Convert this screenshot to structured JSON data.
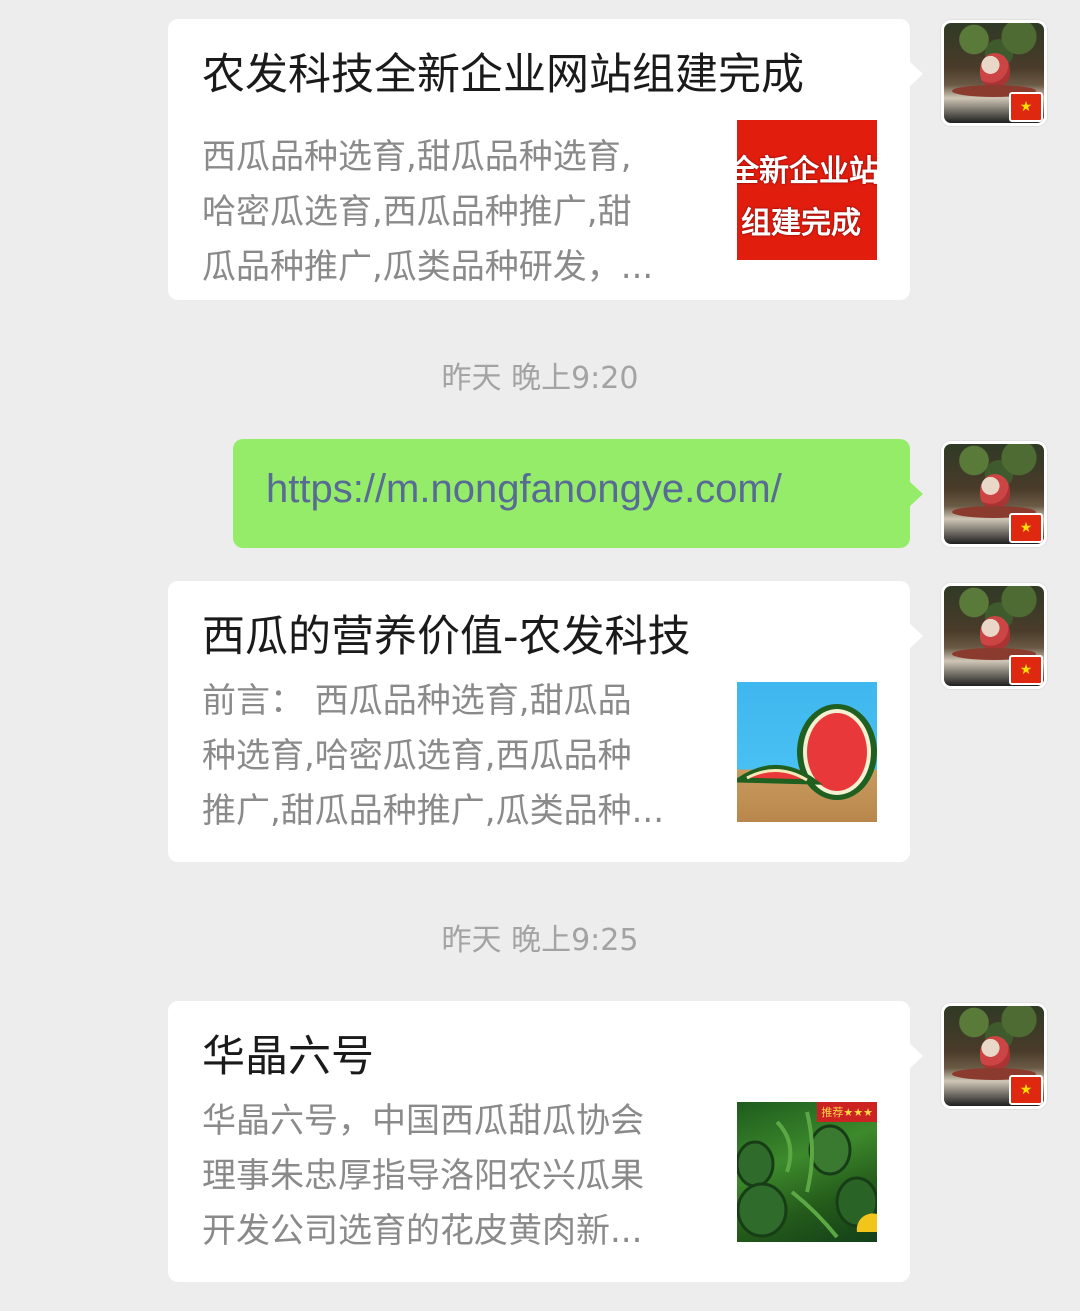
{
  "messages": [
    {
      "type": "article",
      "title": "农发科技全新企业网站组建完成",
      "desc_lines": [
        "西瓜品种选育,甜瓜品种选育,",
        "哈密瓜选育,西瓜品种推广,甜",
        "瓜品种推广,瓜类品种研发，..."
      ],
      "thumb_text": [
        "全新企业站",
        "组建完成"
      ]
    },
    {
      "type": "timestamp",
      "text": "昨天 晚上9:20"
    },
    {
      "type": "link",
      "text": "https://m.nongfanongye.com/"
    },
    {
      "type": "article",
      "title": "西瓜的营养价值-农发科技",
      "desc_lines": [
        "前言：  西瓜品种选育,甜瓜品",
        "种选育,哈密瓜选育,西瓜品种",
        "推广,甜瓜品种推广,瓜类品种..."
      ]
    },
    {
      "type": "timestamp",
      "text": "昨天 晚上9:25"
    },
    {
      "type": "article",
      "title": "华晶六号",
      "desc_lines": [
        "华晶六号，中国西瓜甜瓜协会",
        "理事朱忠厚指导洛阳农兴瓜果",
        "开发公司选育的花皮黄肉新..."
      ],
      "thumb_badge": "推荐★★★"
    }
  ],
  "avatar": {
    "icon": "chinese-flag-icon",
    "flag_glyph": "★"
  },
  "colors": {
    "background": "#ededed",
    "sent_bubble": "#95ec69",
    "link": "#576b95"
  }
}
